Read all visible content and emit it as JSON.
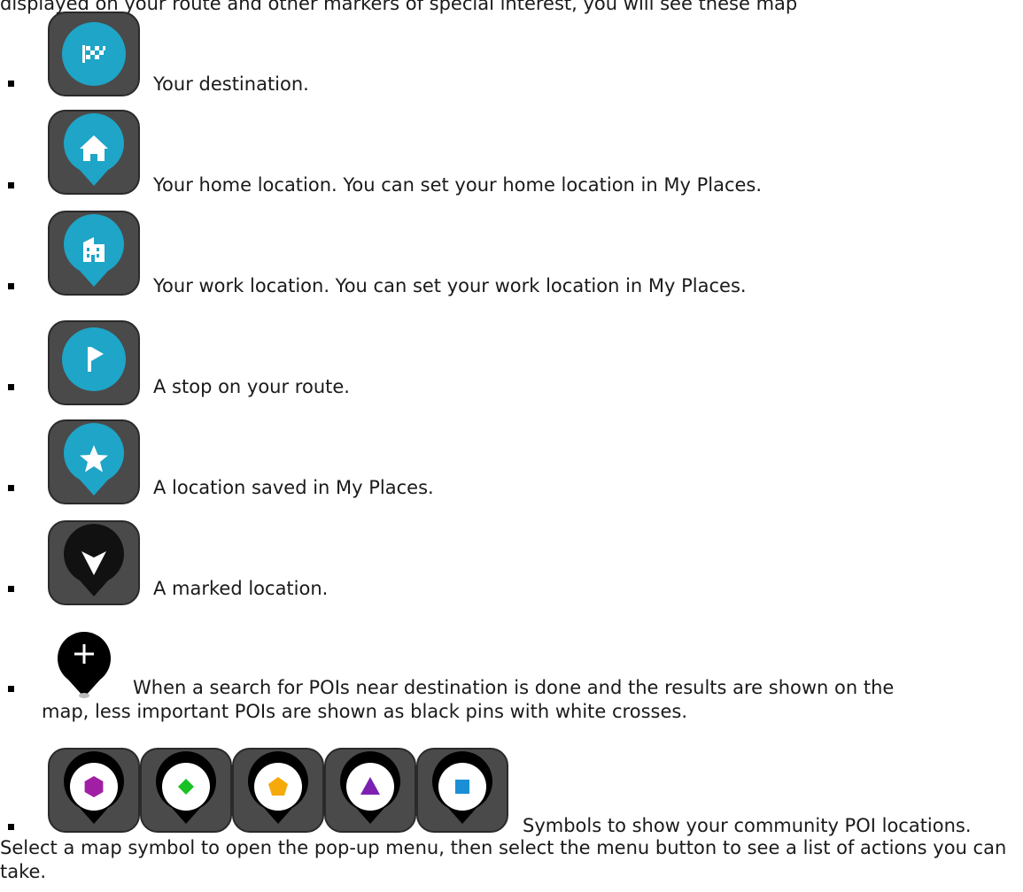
{
  "intro_partial": "displayed on your route and other markers of special interest, you will see these map",
  "items": [
    {
      "icon": "destination-flag-icon",
      "label": "Your destination."
    },
    {
      "icon": "home-icon",
      "label": "Your home location. You can set your home location in My Places."
    },
    {
      "icon": "work-building-icon",
      "label": "Your work location. You can set your work location in My Places."
    },
    {
      "icon": "stop-flag-icon",
      "label": "A stop on your route."
    },
    {
      "icon": "star-icon",
      "label": "A location saved in My Places."
    },
    {
      "icon": "marked-location-icon",
      "label": "A marked location."
    },
    {
      "icon": "plus-pin-icon",
      "label_line1": "When a search for POIs near destination is done and the results are shown on the",
      "label_line2": "map, less important POIs are shown as black pins with white crosses."
    },
    {
      "icons": [
        "hexagon-pin-icon",
        "diamond-pin-icon",
        "pentagon-pin-icon",
        "triangle-pin-icon",
        "square-pin-icon"
      ],
      "label": "Symbols to show your community POI locations."
    }
  ],
  "closing": "Select a map symbol to open the pop-up menu, then select the menu button to see a list of actions you can take.",
  "colors": {
    "tile": "#4a4a4a",
    "teal": "#1ea5c7",
    "purple": "#a11fa5",
    "green": "#19c125",
    "orange": "#f5a90b",
    "violet": "#7d1fb1",
    "blue": "#1a8fd6"
  }
}
